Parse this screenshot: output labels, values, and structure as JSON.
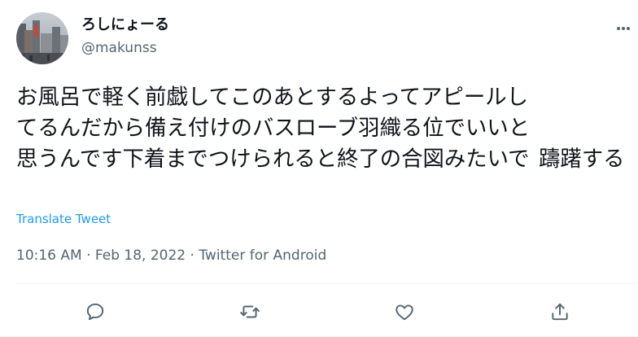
{
  "author": {
    "display_name": "ろしにょーる",
    "handle": "@makunss"
  },
  "tweet": {
    "text_lines": [
      "お風呂で軽く前戯してこのあとするよってアピールし",
      "てるんだから備え付けのバスローブ羽織る位でいいと",
      "思うんです下着までつけられると終了の合図みたいで",
      "躊躇する"
    ]
  },
  "translate_label": "Translate Tweet",
  "meta": {
    "time": "10:16 AM",
    "separator": "·",
    "date": "Feb 18, 2022",
    "source": "Twitter for Android"
  },
  "icons": {
    "more": "more-horizontal-icon",
    "reply": "reply-icon",
    "retweet": "retweet-icon",
    "like": "heart-icon",
    "share": "share-icon"
  },
  "colors": {
    "link": "#1d9bf0",
    "secondary_text": "#536471",
    "primary_text": "#0f1419",
    "icon": "#536471"
  }
}
